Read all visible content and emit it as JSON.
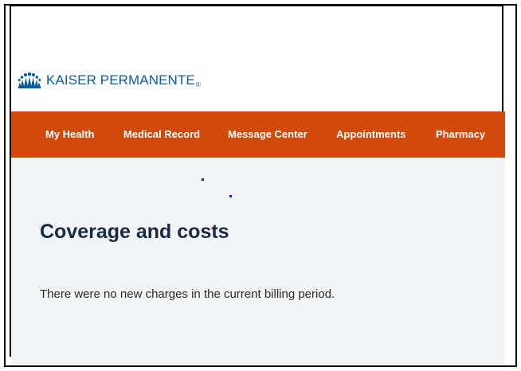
{
  "brand": {
    "name": "KAISER PERMANENTE",
    "registered_mark": "®",
    "logo_icon": "people-figures-icon",
    "color": "#0b5c9e"
  },
  "nav": {
    "background": "#d24a0b",
    "items": [
      {
        "label": "My Health"
      },
      {
        "label": "Medical Record"
      },
      {
        "label": "Message Center"
      },
      {
        "label": "Appointments"
      },
      {
        "label": "Pharmacy"
      }
    ]
  },
  "main": {
    "title": "Coverage and costs",
    "message": "There were no new charges in the current billing period."
  }
}
